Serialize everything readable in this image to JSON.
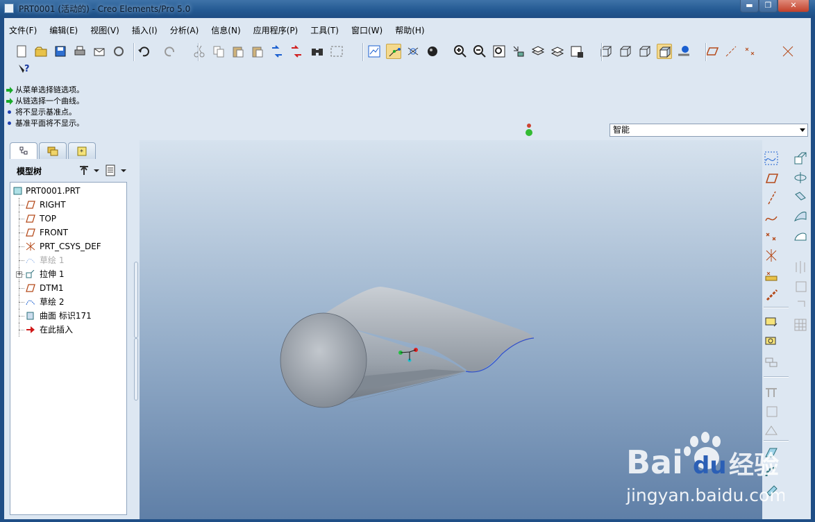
{
  "window": {
    "title": "PRT0001 (活动的) - Creo Elements/Pro 5.0",
    "min": "▬",
    "max": "❐",
    "close": "✕"
  },
  "menu": [
    "文件(F)",
    "编辑(E)",
    "视图(V)",
    "插入(I)",
    "分析(A)",
    "信息(N)",
    "应用程序(P)",
    "工具(T)",
    "窗口(W)",
    "帮助(H)"
  ],
  "toolbar_icons": [
    "new-icon",
    "open-icon",
    "save-icon",
    "print-icon",
    "send-mail-icon",
    "send-link-icon",
    "undo-icon",
    "redo-icon",
    "cut-icon",
    "copy-icon",
    "paste-icon",
    "paste-special-icon",
    "regenerate-icon",
    "regen-manager-icon",
    "find-icon",
    "select-box-icon",
    "datum-display-icon",
    "spin-center-icon",
    "orient-icon",
    "shade-icon",
    "zoom-in-icon",
    "zoom-out-icon",
    "refit-icon",
    "saved-views-icon",
    "layers-icon",
    "view-manager-icon",
    "appearance-icon",
    "wireframe-icon",
    "hidden-line-icon",
    "no-hidden-icon",
    "shading-icon",
    "enhanced-realism-icon",
    "datum-plane-display-icon",
    "datum-axis-display-icon",
    "datum-point-display-icon",
    "csys-display-icon",
    "context-help-icon"
  ],
  "messages": [
    {
      "type": "arrow",
      "text": "从菜单选择链选项。"
    },
    {
      "type": "arrow",
      "text": "从链选择一个曲线。"
    },
    {
      "type": "dot",
      "text": "将不显示基准点。"
    },
    {
      "type": "dot",
      "text": "基准平面将不显示。"
    }
  ],
  "filter": {
    "value": "智能"
  },
  "model_tree": {
    "header": "模型树",
    "items": [
      {
        "label": "PRT0001.PRT",
        "icon": "part-icon",
        "indent": 0,
        "dim": false
      },
      {
        "label": "RIGHT",
        "icon": "datum-plane-icon",
        "indent": 1,
        "dim": false
      },
      {
        "label": "TOP",
        "icon": "datum-plane-icon",
        "indent": 1,
        "dim": false
      },
      {
        "label": "FRONT",
        "icon": "datum-plane-icon",
        "indent": 1,
        "dim": false
      },
      {
        "label": "PRT_CSYS_DEF",
        "icon": "csys-icon",
        "indent": 1,
        "dim": false
      },
      {
        "label": "草绘 1",
        "icon": "sketch-icon",
        "indent": 1,
        "dim": true
      },
      {
        "label": "拉伸 1",
        "icon": "extrude-icon",
        "indent": 1,
        "dim": false,
        "expandable": true
      },
      {
        "label": "DTM1",
        "icon": "datum-plane-icon",
        "indent": 1,
        "dim": false
      },
      {
        "label": "草绘 2",
        "icon": "sketch-icon",
        "indent": 1,
        "dim": false
      },
      {
        "label": "曲面 标识171",
        "icon": "surface-icon",
        "indent": 1,
        "dim": false
      },
      {
        "label": "在此插入",
        "icon": "insert-here-icon",
        "indent": 1,
        "dim": false
      }
    ]
  },
  "watermark": {
    "brand": "Bai",
    "brand2": "du",
    "cn": "经验",
    "url": "jingyan.baidu.com"
  },
  "colors": {
    "accent": "#1f4e86",
    "highlight": "#f4d98d",
    "viewport_top": "#d6e2ee",
    "viewport_bottom": "#5f7fa7"
  }
}
